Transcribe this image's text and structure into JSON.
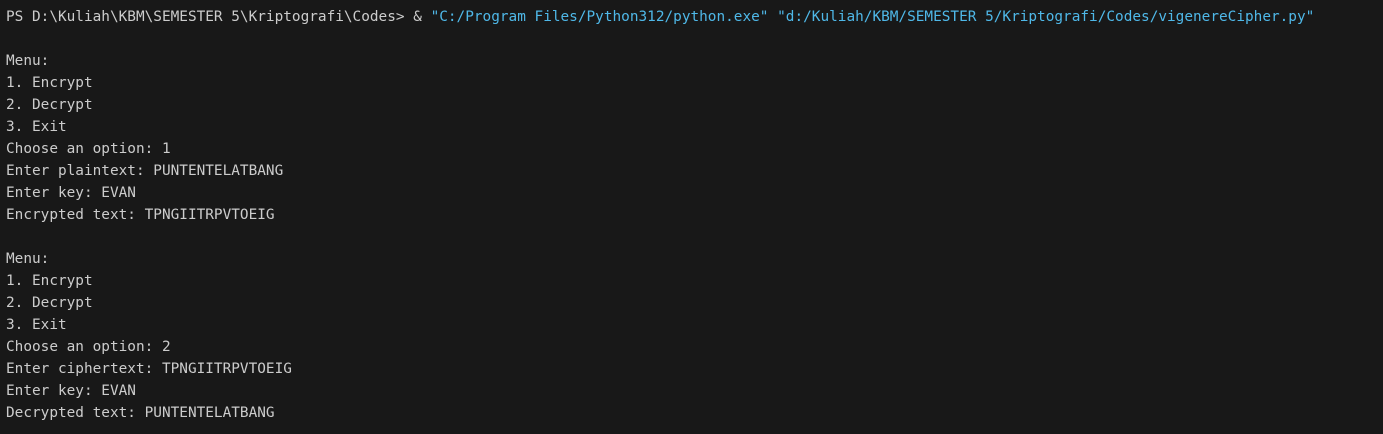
{
  "terminal": {
    "prompt": "PS D:\\Kuliah\\KBM\\SEMESTER 5\\Kriptografi\\Codes>",
    "call_operator": "&",
    "python_path": "\"C:/Program Files/Python312/python.exe\"",
    "script_path": "\"d:/Kuliah/KBM/SEMESTER 5/Kriptografi/Codes/vigenereCipher.py\"",
    "session1": {
      "menu_title": "Menu:",
      "option1": "1. Encrypt",
      "option2": "2. Decrypt",
      "option3": "3. Exit",
      "choose": "Choose an option: 1",
      "input_text": "Enter plaintext: PUNTENTELATBANG",
      "key": "Enter key: EVAN",
      "result": "Encrypted text: TPNGIITRPVTOEIG"
    },
    "session2": {
      "menu_title": "Menu:",
      "option1": "1. Encrypt",
      "option2": "2. Decrypt",
      "option3": "3. Exit",
      "choose": "Choose an option: 2",
      "input_text": "Enter ciphertext: TPNGIITRPVTOEIG",
      "key": "Enter key: EVAN",
      "result": "Decrypted text: PUNTENTELATBANG"
    }
  },
  "colors": {
    "background": "#181818",
    "text": "#cccccc",
    "string": "#4fb8e8"
  }
}
